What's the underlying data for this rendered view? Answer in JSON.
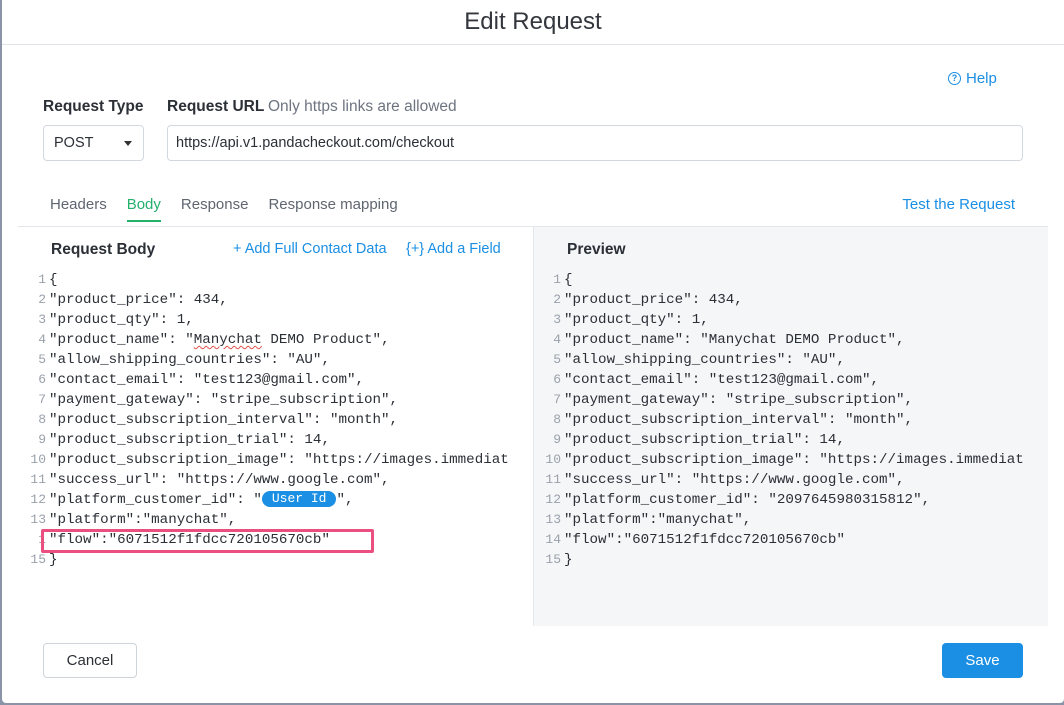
{
  "modal": {
    "title": "Edit Request",
    "help_label": "Help"
  },
  "request": {
    "type_label": "Request Type",
    "url_label": "Request URL",
    "url_hint": "Only https links are allowed",
    "type_value": "POST",
    "url_value": "https://api.v1.pandacheckout.com/checkout"
  },
  "tabs": [
    {
      "label": "Headers",
      "active": false
    },
    {
      "label": "Body",
      "active": true
    },
    {
      "label": "Response",
      "active": false
    },
    {
      "label": "Response mapping",
      "active": false
    }
  ],
  "test_label": "Test the Request",
  "body_pane": {
    "title": "Request Body",
    "add_contact_label": "+ Add Full Contact Data",
    "add_field_label": "{+} Add a Field",
    "lines": {
      "l1": "{",
      "l2": "\"product_price\": 434,",
      "l3": "\"product_qty\": 1,",
      "l4_a": "\"product_name\": \"",
      "l4_b": "Manychat",
      "l4_c": " DEMO Product\",",
      "l5": "\"allow_shipping_countries\": \"AU\",",
      "l6": "\"contact_email\": \"test123@gmail.com\",",
      "l7": "\"payment_gateway\": \"stripe_subscription\",",
      "l8": "\"product_subscription_interval\": \"month\",",
      "l9": "\"product_subscription_trial\": 14,",
      "l10": "\"product_subscription_image\": \"https://images.immediat",
      "l11": "\"success_url\": \"https://www.google.com\",",
      "l12_a": "\"platform_customer_id\": \"",
      "l12_chip": "User Id",
      "l12_c": "\",",
      "l13": "\"platform\":\"manychat\",",
      "l14": "\"flow\":\"6071512f1fdcc720105670cb\"",
      "l15": "}"
    }
  },
  "preview_pane": {
    "title": "Preview",
    "lines": {
      "l1": "{",
      "l2": "\"product_price\": 434,",
      "l3": "\"product_qty\": 1,",
      "l4": "\"product_name\": \"Manychat DEMO Product\",",
      "l5": "\"allow_shipping_countries\": \"AU\",",
      "l6": "\"contact_email\": \"test123@gmail.com\",",
      "l7": "\"payment_gateway\": \"stripe_subscription\",",
      "l8": "\"product_subscription_interval\": \"month\",",
      "l9": "\"product_subscription_trial\": 14,",
      "l10": "\"product_subscription_image\": \"https://images.immediat",
      "l11": "\"success_url\": \"https://www.google.com\",",
      "l12": "\"platform_customer_id\": \"2097645980315812\",",
      "l13": "\"platform\":\"manychat\",",
      "l14": "\"flow\":\"6071512f1fdcc720105670cb\"",
      "l15": "}"
    }
  },
  "line_numbers": {
    "n1": "1",
    "n2": "2",
    "n3": "3",
    "n4": "4",
    "n5": "5",
    "n6": "6",
    "n7": "7",
    "n8": "8",
    "n9": "9",
    "n10": "10",
    "n11": "11",
    "n12": "12",
    "n13": "13",
    "n14": "14",
    "n15": "15",
    "n14_cut": "1"
  },
  "footer": {
    "cancel_label": "Cancel",
    "save_label": "Save"
  },
  "colors": {
    "accent": "#1a8fe3",
    "active_tab": "#25b06c",
    "highlight": "#ea4f7f"
  }
}
